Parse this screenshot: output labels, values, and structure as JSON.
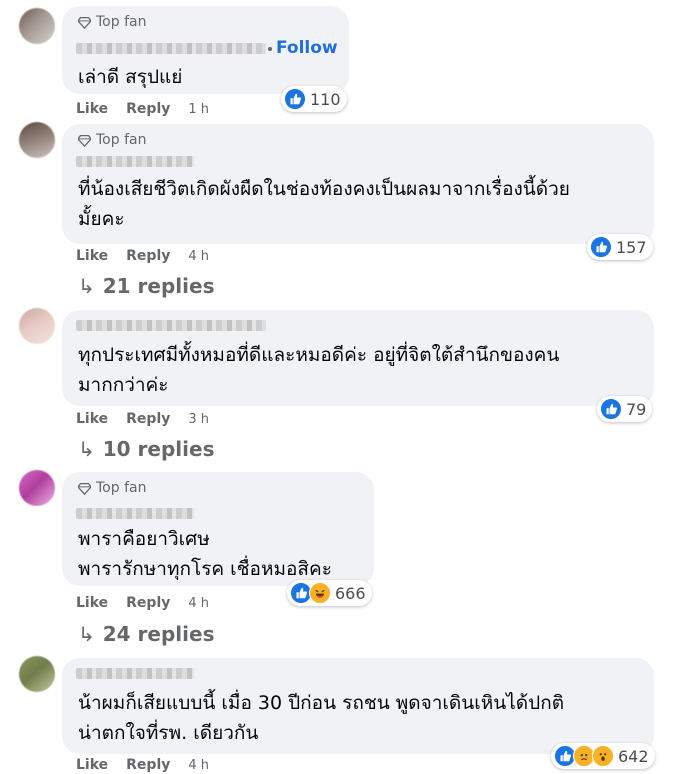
{
  "comments": [
    {
      "badge": "Top fan",
      "follow": "Follow",
      "text_lines": [
        "เล่าดี สรุปแย่"
      ],
      "actions": {
        "like": "Like",
        "reply": "Reply",
        "time": "1 h"
      },
      "reactions": {
        "types": [
          "like"
        ],
        "count": "110"
      }
    },
    {
      "badge": "Top fan",
      "text_lines": [
        "ที่น้องเสียชีวิตเกิดผังผืดในช่องท้องคงเป็นผลมาจากเรื่องนี้ด้วย",
        "มั้ยคะ"
      ],
      "actions": {
        "like": "Like",
        "reply": "Reply",
        "time": "4 h"
      },
      "reactions": {
        "types": [
          "like"
        ],
        "count": "157"
      },
      "replies": "21 replies"
    },
    {
      "text_lines": [
        "ทุกประเทศมีทั้งหมอที่ดีและหมอดีค่ะ อยู่ที่จิตใต้สำนึกของคน",
        "มากกว่าค่ะ"
      ],
      "actions": {
        "like": "Like",
        "reply": "Reply",
        "time": "3 h"
      },
      "reactions": {
        "types": [
          "like"
        ],
        "count": "79"
      },
      "replies": "10 replies"
    },
    {
      "badge": "Top fan",
      "text_lines": [
        "พาราคือยาวิเศษ",
        "พารารักษาทุกโรค เชื่อหมอสิคะ"
      ],
      "actions": {
        "like": "Like",
        "reply": "Reply",
        "time": "4 h"
      },
      "reactions": {
        "types": [
          "like",
          "haha"
        ],
        "count": "666"
      },
      "replies": "24 replies"
    },
    {
      "text_lines": [
        "น้าผมก็เสียแบบนี้ เมื่อ 30 ปีก่อน รถชน พูดจาเดินเหินได้ปกติ",
        "น่าตกใจที่รพ. เดียวกัน"
      ],
      "actions": {
        "like": "Like",
        "reply": "Reply",
        "time": "4 h"
      },
      "reactions": {
        "types": [
          "like",
          "sad",
          "wow"
        ],
        "count": "642"
      }
    }
  ]
}
